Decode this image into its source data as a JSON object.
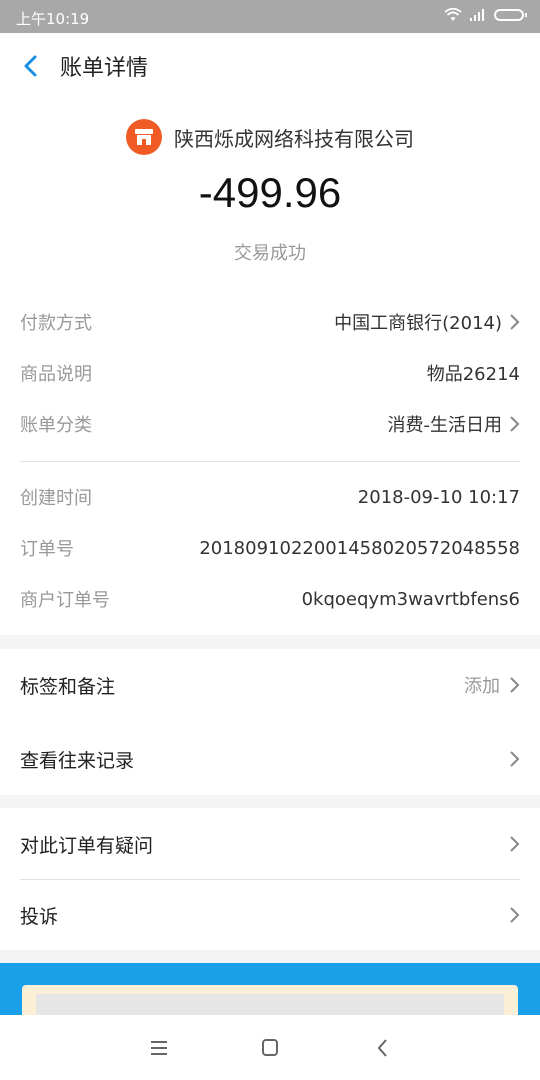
{
  "status_bar": {
    "time": "上午10:19"
  },
  "header": {
    "title": "账单详情"
  },
  "summary": {
    "merchant_name": "陕西烁成网络科技有限公司",
    "amount": "-499.96",
    "status": "交易成功"
  },
  "details": [
    {
      "label": "付款方式",
      "value": "中国工商银行(2014)",
      "arrow": true
    },
    {
      "label": "商品说明",
      "value": "物品26214",
      "arrow": false
    },
    {
      "label": "账单分类",
      "value": "消费-生活日用",
      "arrow": true
    }
  ],
  "order_info": [
    {
      "label": "创建时间",
      "value": "2018-09-10 10:17"
    },
    {
      "label": "订单号",
      "value": "2018091022001458020572048558"
    },
    {
      "label": "商户订单号",
      "value": "0kqoeqym3wavrtbfens6"
    }
  ],
  "actions": {
    "tags_label": "标签和备注",
    "tags_value": "添加",
    "history_label": "查看往来记录"
  },
  "support": {
    "question_label": "对此订单有疑问",
    "complaint_label": "投诉"
  },
  "colors": {
    "accent": "#1aa0e8",
    "merchant": "#f05a24"
  }
}
